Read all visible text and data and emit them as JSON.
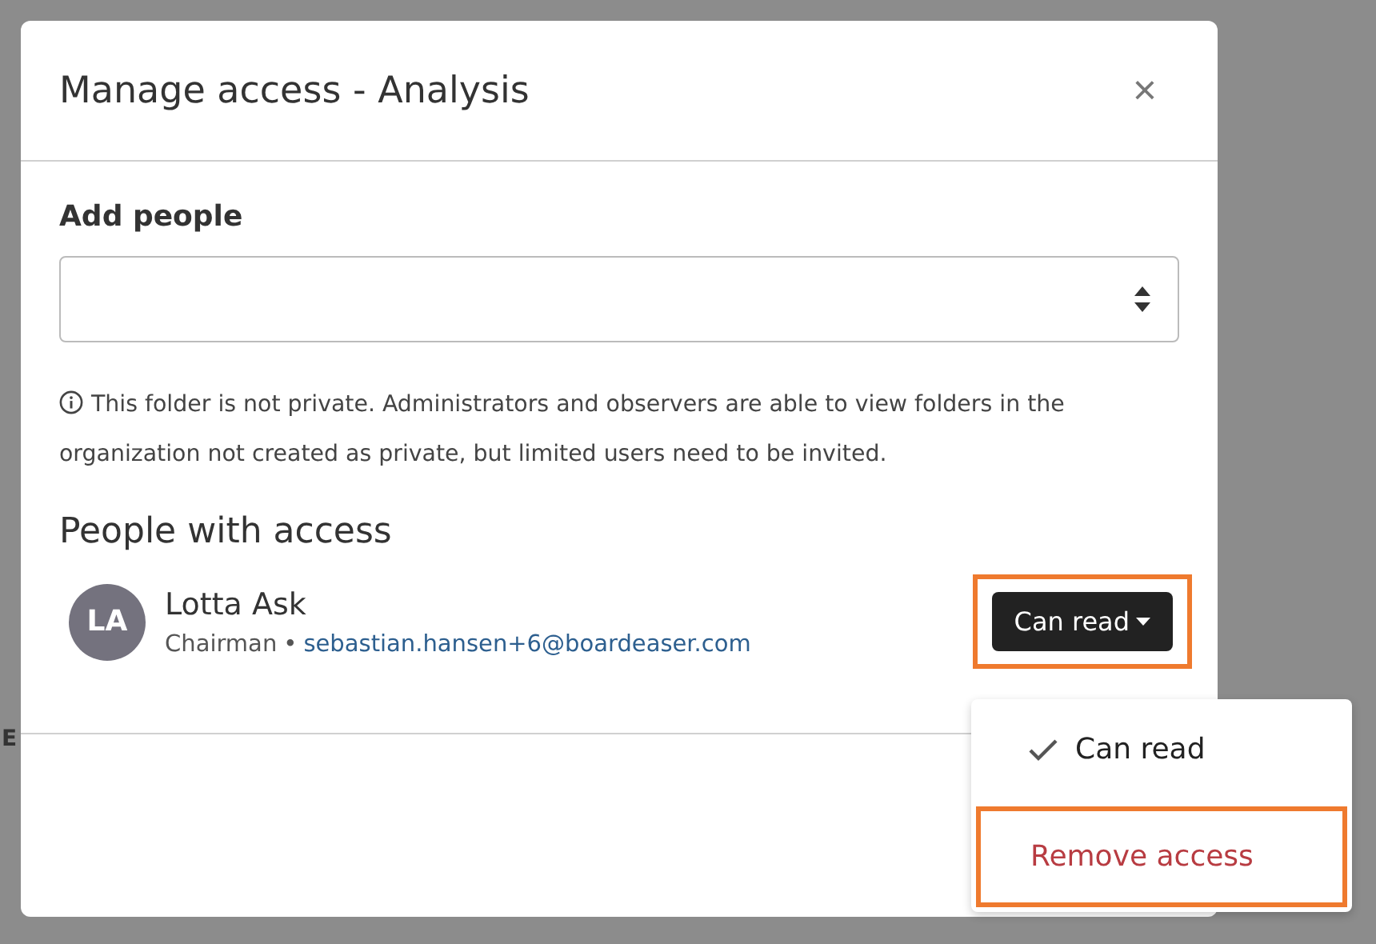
{
  "background": {
    "fragment": "E"
  },
  "dialog": {
    "title": "Manage access - Analysis",
    "close_label": "×",
    "add_people": {
      "label": "Add people"
    },
    "info": "This folder is not private. Administrators and observers are able to view folders in the organization not created as private, but limited users need to be invited.",
    "people_heading": "People with access",
    "people": [
      {
        "initials": "LA",
        "name": "Lotta Ask",
        "role": "Chairman",
        "separator": "•",
        "email": "sebastian.hansen+6@boardeaser.com",
        "permission": "Can read",
        "highlighted": true
      }
    ]
  },
  "menu": {
    "items": [
      {
        "kind": "option",
        "label": "Can read",
        "selected": true,
        "highlighted": false
      },
      {
        "kind": "danger",
        "label": "Remove access",
        "selected": false,
        "highlighted": true
      }
    ]
  }
}
